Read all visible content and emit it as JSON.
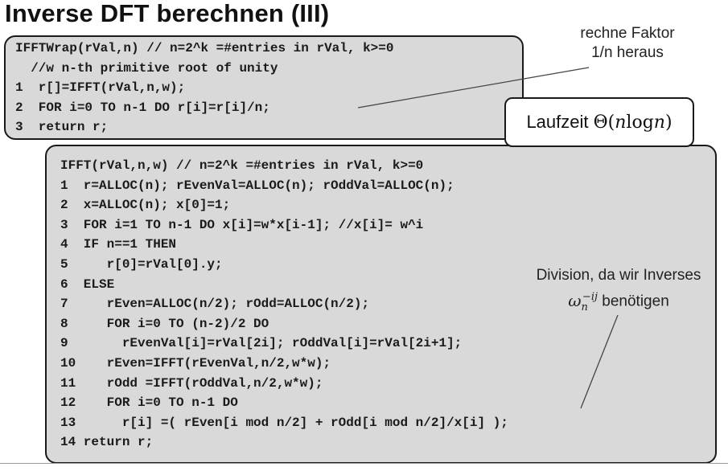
{
  "slide": {
    "title": "Inverse DFT berechnen (III)"
  },
  "wrap_code": {
    "lines": [
      "IFFTWrap(rVal,n) // n=2^k =#entries in rVal, k>=0",
      "  //w n-th primitive root of unity",
      "1  r[]=IFFT(rVal,n,w);",
      "2  FOR i=0 TO n-1 DO r[i]=r[i]/n;",
      "3  return r;"
    ]
  },
  "ifft_code": {
    "lines": [
      "IFFT(rVal,n,w) // n=2^k =#entries in rVal, k>=0",
      "1  r=ALLOC(n); rEvenVal=ALLOC(n); rOddVal=ALLOC(n);",
      "2  x=ALLOC(n); x[0]=1;",
      "3  FOR i=1 TO n-1 DO x[i]=w*x[i-1]; //x[i]= w^i",
      "4  IF n==1 THEN",
      "5     r[0]=rVal[0].y;",
      "6  ELSE",
      "7     rEven=ALLOC(n/2); rOdd=ALLOC(n/2);",
      "8     FOR i=0 TO (n-2)/2 DO",
      "9       rEvenVal[i]=rVal[2i]; rOddVal[i]=rVal[2i+1];",
      "10    rEven=IFFT(rEvenVal,n/2,w*w);",
      "11    rOdd =IFFT(rOddVal,n/2,w*w);",
      "12    FOR i=0 TO n-1 DO",
      "13      r[i] =( rEven[i mod n/2] + rOdd[i mod n/2]/x[i] );",
      "14 return r;"
    ]
  },
  "annotations": {
    "factor_line1": "rechne Faktor",
    "factor_line2": "1/n heraus",
    "runtime_label": "Laufzeit",
    "runtime_theta": "Θ(",
    "runtime_n1": "n",
    "runtime_log": " log ",
    "runtime_n2": "n",
    "runtime_close": ")",
    "division_line1": "Division, da wir Inverses",
    "omega_symbol": "ω",
    "omega_sub": "n",
    "omega_sup": "−ij",
    "division_line2_rest": " benötigen"
  }
}
